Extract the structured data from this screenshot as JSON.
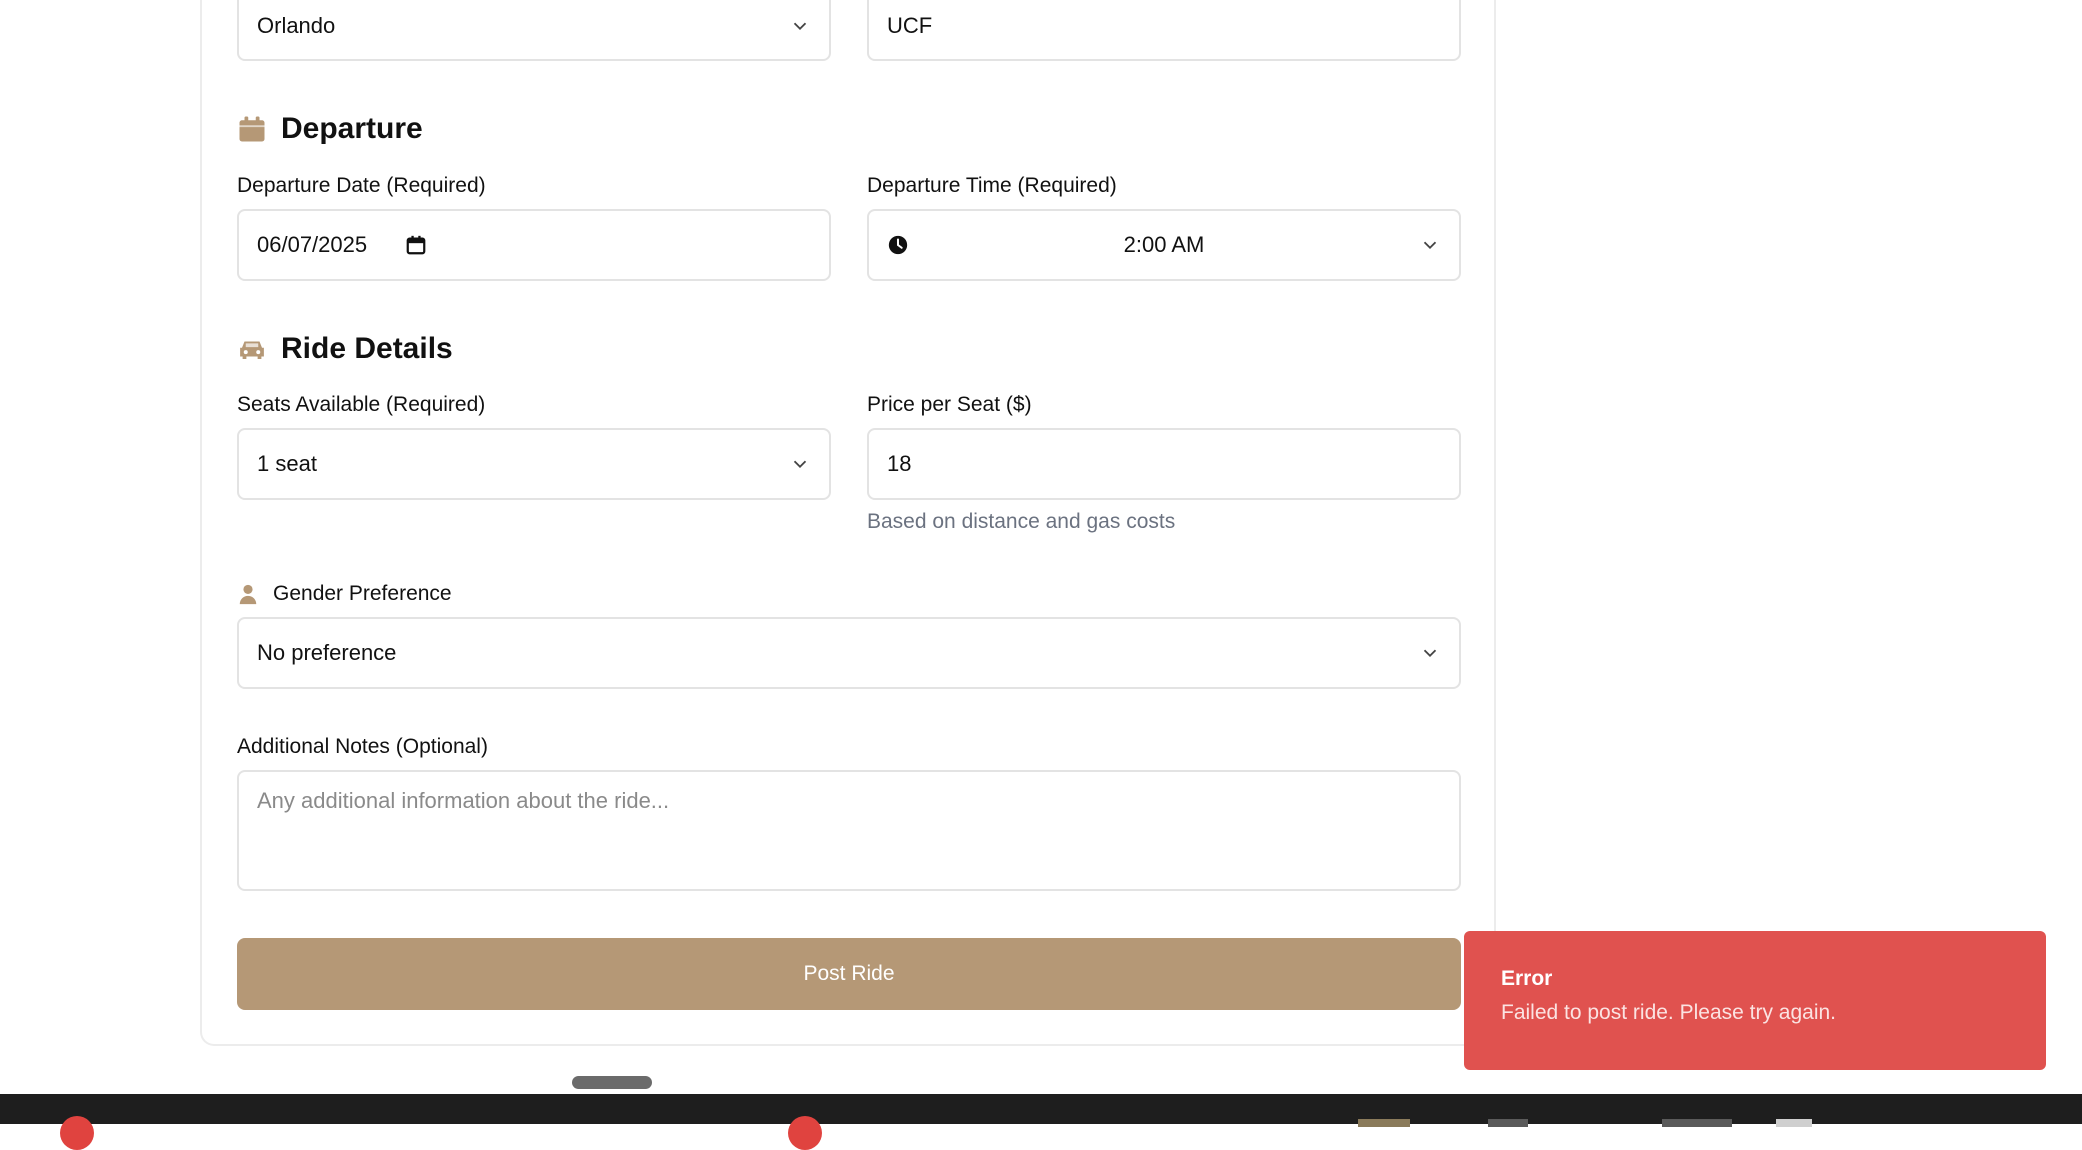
{
  "origin": {
    "value": "Orlando"
  },
  "destination": {
    "value": "UCF"
  },
  "departure": {
    "title": "Departure",
    "date_label": "Departure Date (Required)",
    "date_value": "06/07/2025",
    "time_label": "Departure Time (Required)",
    "time_value": "2:00 AM"
  },
  "ride_details": {
    "title": "Ride Details",
    "seats_label": "Seats Available (Required)",
    "seats_value": "1 seat",
    "price_label": "Price per Seat ($)",
    "price_value": "18",
    "price_helper": "Based on distance and gas costs"
  },
  "gender": {
    "label": "Gender Preference",
    "value": "No preference"
  },
  "notes": {
    "label": "Additional Notes (Optional)",
    "placeholder": "Any additional information about the ride..."
  },
  "submit": {
    "label": "Post Ride"
  },
  "toast": {
    "title": "Error",
    "message": "Failed to post ride. Please try again."
  },
  "colors": {
    "accent": "#b59876",
    "error": "#e0524f",
    "border": "#e3e3e3",
    "helper_text": "#6b7280"
  },
  "icons": [
    "chevron-down-icon",
    "calendar-icon",
    "clock-icon",
    "car-icon",
    "person-icon",
    "date-picker-icon"
  ]
}
